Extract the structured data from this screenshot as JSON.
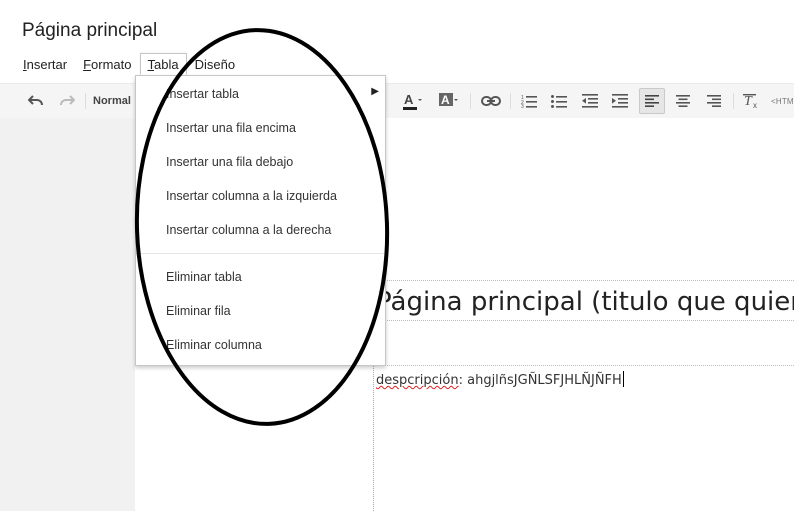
{
  "document": {
    "title": "Página principal"
  },
  "menubar": {
    "items": [
      {
        "label": "Insertar",
        "underline": "I",
        "rest": "nsertar"
      },
      {
        "label": "Formato",
        "underline": "F",
        "rest": "ormato"
      },
      {
        "label": "Tabla",
        "underline": "T",
        "rest": "abla"
      },
      {
        "label": "Diseño",
        "underline": "",
        "rest": "Diseño"
      }
    ]
  },
  "toolbar": {
    "style_select": "Normal",
    "html_toggle": "<HTM",
    "icons": [
      "undo-icon",
      "redo-icon",
      "text-color-icon",
      "highlight-color-icon",
      "link-icon",
      "numbered-list-icon",
      "bulleted-list-icon",
      "decrease-indent-icon",
      "increase-indent-icon",
      "align-left-icon",
      "align-center-icon",
      "align-right-icon",
      "clear-formatting-icon"
    ]
  },
  "table_menu": {
    "items": [
      {
        "label": "Insertar tabla",
        "submenu": "▶"
      },
      {
        "label": "Insertar una fila encima"
      },
      {
        "label": "Insertar una fila debajo"
      },
      {
        "label": "Insertar columna a la izquierda"
      },
      {
        "label": "Insertar columna a la derecha"
      },
      {
        "label": "Eliminar tabla"
      },
      {
        "label": "Eliminar fila"
      },
      {
        "label": "Eliminar columna"
      }
    ]
  },
  "content": {
    "heading": "Página principal (titulo que quieras",
    "description_label": "despcripción",
    "description_sep": ": ",
    "description_value": "ahgjlñsJGÑLSFJHLÑJÑFH"
  },
  "colors": {
    "toolbar_bg": "#f5f5f5",
    "left_panel_bg": "#f1f1f1",
    "annotation_stroke": "#000000"
  }
}
